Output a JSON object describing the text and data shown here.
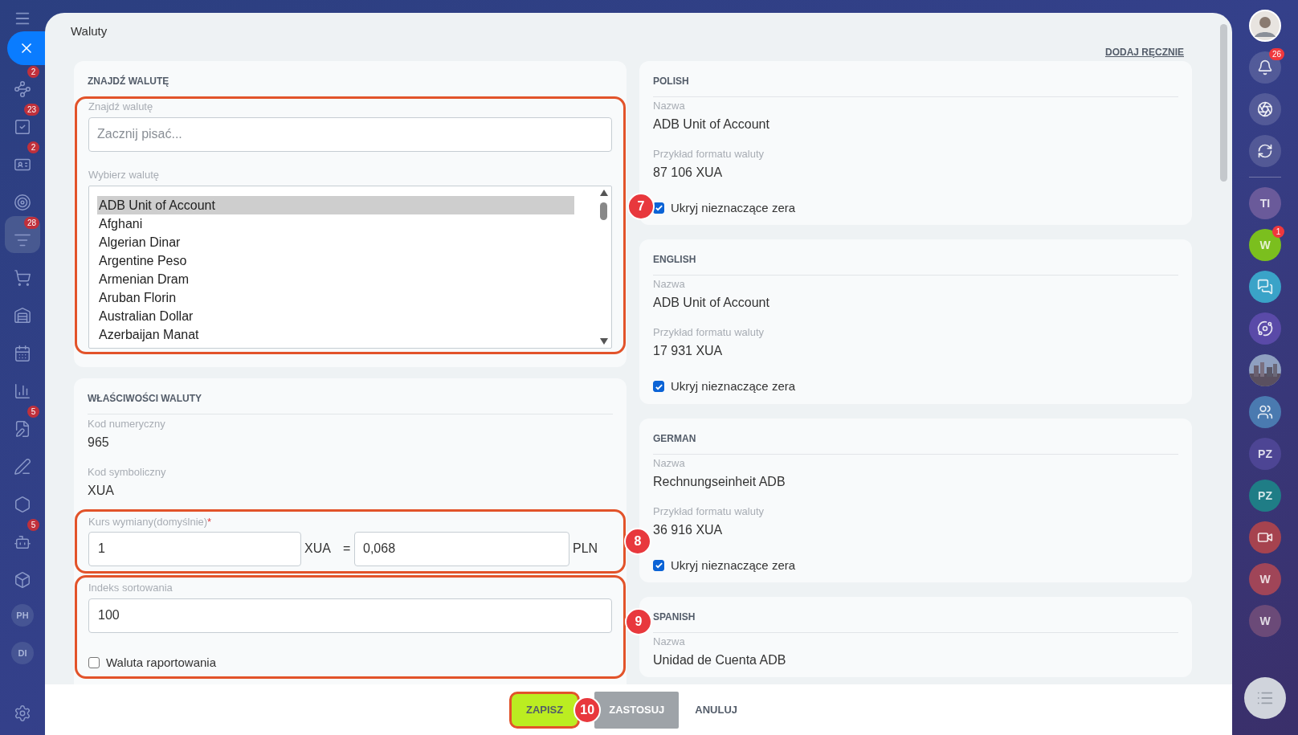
{
  "window": {
    "title": "Waluty"
  },
  "add_manually_link": "DODAJ RĘCZNIE",
  "left_nav": {
    "close_selected": true,
    "items": [
      {
        "kind": "icon",
        "selected": false,
        "badge": "2"
      },
      {
        "kind": "icon",
        "selected": false,
        "badge": "23"
      },
      {
        "kind": "icon",
        "selected": false,
        "badge": "2"
      },
      {
        "kind": "icon",
        "selected": false
      },
      {
        "kind": "icon",
        "selected": true,
        "badge": "28"
      },
      {
        "kind": "icon",
        "selected": false
      },
      {
        "kind": "icon",
        "selected": false
      },
      {
        "kind": "icon",
        "selected": false
      },
      {
        "kind": "icon",
        "selected": false
      },
      {
        "kind": "icon",
        "selected": false,
        "badge": "5"
      },
      {
        "kind": "icon",
        "selected": false
      },
      {
        "kind": "icon",
        "selected": false
      },
      {
        "kind": "icon",
        "selected": false,
        "badge": "5"
      },
      {
        "kind": "icon",
        "selected": false
      },
      {
        "kind": "initials",
        "selected": false,
        "label": "PH"
      },
      {
        "kind": "initials",
        "selected": false,
        "label": "DI"
      }
    ]
  },
  "find_section": {
    "heading": "ZNAJDŹ WALUTĘ",
    "marker": "7",
    "search_label": "Znajdź walutę",
    "search_placeholder": "Zacznij pisać...",
    "list_label": "Wybierz walutę",
    "currencies": [
      {
        "name": "ADB Unit of Account",
        "selected": true
      },
      {
        "name": "Afghani",
        "selected": false
      },
      {
        "name": "Algerian Dinar",
        "selected": false
      },
      {
        "name": "Argentine Peso",
        "selected": false
      },
      {
        "name": "Armenian Dram",
        "selected": false
      },
      {
        "name": "Aruban Florin",
        "selected": false
      },
      {
        "name": "Australian Dollar",
        "selected": false
      },
      {
        "name": "Azerbaijan Manat",
        "selected": false
      }
    ]
  },
  "properties": {
    "heading": "WŁAŚCIWOŚCI WALUTY",
    "numeric_code_label": "Kod numeryczny",
    "numeric_code": "965",
    "symbol_code_label": "Kod symboliczny",
    "symbol_code": "XUA",
    "rate": {
      "marker": "8",
      "label": "Kurs wymiany(domyślnie)",
      "required_mark": "*",
      "amount": "1",
      "from_currency": "XUA",
      "equals": "=",
      "value": "0,068",
      "to_currency": "PLN"
    },
    "sort": {
      "marker": "9",
      "label": "Indeks sortowania",
      "value": "100",
      "reporting_label": "Waluta raportowania",
      "reporting": false
    }
  },
  "languages": [
    {
      "heading": "POLISH",
      "name_label": "Nazwa",
      "name": "ADB Unit of Account",
      "format_label": "Przykład formatu waluty",
      "format_example": "87 106 XUA",
      "hide_zeros_label": "Ukryj nieznaczące zera",
      "hide_zeros": true
    },
    {
      "heading": "ENGLISH",
      "name_label": "Nazwa",
      "name": "ADB Unit of Account",
      "format_label": "Przykład formatu waluty",
      "format_example": "17 931 XUA",
      "hide_zeros_label": "Ukryj nieznaczące zera",
      "hide_zeros": true
    },
    {
      "heading": "GERMAN",
      "name_label": "Nazwa",
      "name": "Rechnungseinheit ADB",
      "format_label": "Przykład formatu waluty",
      "format_example": "36 916 XUA",
      "hide_zeros_label": "Ukryj nieznaczące zera",
      "hide_zeros": true
    },
    {
      "heading": "SPANISH",
      "name_label": "Nazwa",
      "name": "Unidad de Cuenta ADB"
    }
  ],
  "footer": {
    "marker": "10",
    "buttons": [
      {
        "label": "ZAPISZ",
        "kind": "primary"
      },
      {
        "label": "ZASTOSUJ",
        "kind": "secondary"
      },
      {
        "label": "ANULUJ",
        "kind": "link"
      }
    ]
  },
  "right_bar": {
    "items": [
      {
        "kind": "avatar"
      },
      {
        "kind": "icon",
        "badge": "26"
      },
      {
        "kind": "icon"
      },
      {
        "kind": "icon"
      },
      {
        "kind": "divider"
      },
      {
        "kind": "initials",
        "label": "TI",
        "color": "#6a5a9a"
      },
      {
        "kind": "initials",
        "label": "W",
        "color": "#7bbf1e",
        "badge": "1"
      },
      {
        "kind": "icon",
        "color": "#3aa3c8"
      },
      {
        "kind": "icon",
        "color": "#5a4aa8"
      },
      {
        "kind": "picture"
      },
      {
        "kind": "icon",
        "color": "#4a7ab0"
      },
      {
        "kind": "initials",
        "label": "PZ",
        "color": "#4d4594"
      },
      {
        "kind": "initials",
        "label": "PZ",
        "color": "#1f7d86"
      },
      {
        "kind": "icon",
        "color": "#a6434f"
      },
      {
        "kind": "initials",
        "label": "W",
        "color": "#a04558"
      },
      {
        "kind": "initials",
        "label": "W",
        "color": "#6b4a78"
      }
    ]
  }
}
